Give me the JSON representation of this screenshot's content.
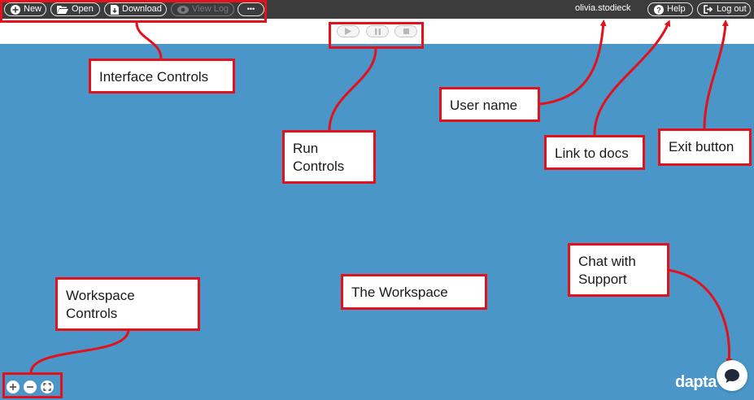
{
  "toolbar": {
    "new_label": "New",
    "open_label": "Open",
    "download_label": "Download",
    "view_log_label": "View Log",
    "more_label": "•••"
  },
  "user": {
    "name": "olivia.stodieck"
  },
  "header_right": {
    "help_label": "Help",
    "logout_label": "Log out"
  },
  "callouts": {
    "interface_controls": "Interface Controls",
    "run_controls_line1": "Run",
    "run_controls_line2": "Controls",
    "user_name": "User name",
    "link_to_docs": "Link to docs",
    "exit_button": "Exit button",
    "chat_line1": "Chat with",
    "chat_line2": "Support",
    "workspace_controls_line1": "Workspace",
    "workspace_controls_line2": "Controls",
    "the_workspace": "The Workspace"
  },
  "brand": {
    "logo_text": "dapta"
  },
  "colors": {
    "workspace_bg": "#4a96c8",
    "topbar_bg": "#3c3c3c",
    "annotation_red": "#e3111b"
  }
}
